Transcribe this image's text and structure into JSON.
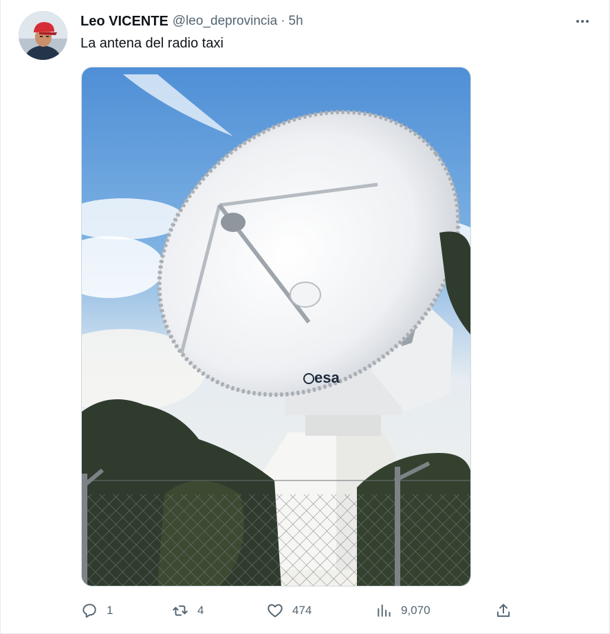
{
  "tweet": {
    "author_name": "Leo VICENTE",
    "author_handle": "@leo_deprovincia",
    "separator": "·",
    "time": "5h",
    "text": "La antena del radio taxi",
    "image_logo_text": "esa"
  },
  "actions": {
    "reply_count": "1",
    "retweet_count": "4",
    "like_count": "474",
    "views_count": "9,070"
  },
  "icons": {
    "more": "more-icon",
    "reply": "reply-icon",
    "retweet": "retweet-icon",
    "like": "heart-icon",
    "views": "views-icon",
    "share": "share-icon"
  },
  "colors": {
    "text_primary": "#0f1419",
    "text_secondary": "#536471",
    "border": "#e7e9ea"
  }
}
